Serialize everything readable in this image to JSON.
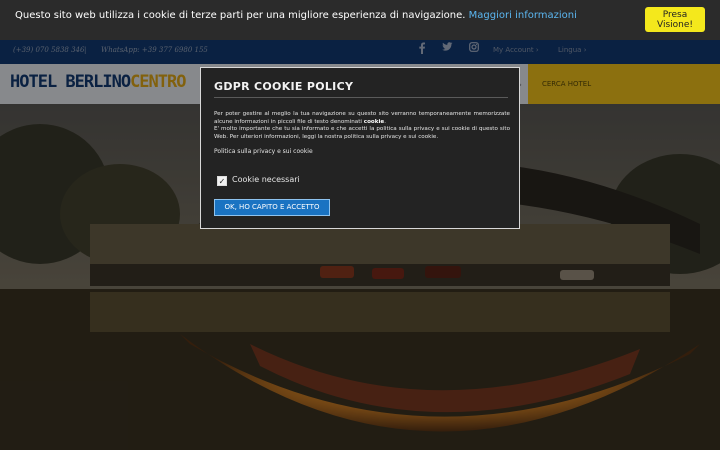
{
  "cookie_bar": {
    "message": "Questo sito web utilizza i cookie di terze parti per una migliore esperienza di navigazione.",
    "link": "Maggiori informazioni",
    "accept_button": "Presa Visione!"
  },
  "topbar": {
    "phone": "(+39) 070 5838 346",
    "divider": "|",
    "whatsapp": "WhatsApp: +39 377 6980 155",
    "icons": [
      "facebook-icon",
      "twitter-icon",
      "instagram-icon"
    ],
    "my_account": "My Account",
    "language": "Lingua"
  },
  "header": {
    "logo_part1": "HOTEL BERLINO",
    "logo_part2": "CENTRO",
    "cerca_hotel": "CERCA HOTEL"
  },
  "modal": {
    "title": "GDPR COOKIE POLICY",
    "paragraph1": "Per poter gestire al meglio la tua navigazione su questo sito verranno temporaneamente memorizzate alcune informazioni in piccoli file di testo denominati",
    "paragraph1_bold": "cookie",
    "paragraph2": "E' molto importante che tu sia informato e che accetti la politica sulla privacy e sui cookie di questo sito Web. Per ulteriori informazioni, leggi la nostra politica sulla privacy e sui cookie.",
    "privacy_link": "Politica sulla privacy e sui cookie",
    "checkbox_label": "Cookie necessari",
    "checkbox_checked": true,
    "accept_button": "OK, HO CAPITO E ACCETTO"
  },
  "colors": {
    "topbar_bg": "#123a72",
    "accent_yellow": "#f1c21a",
    "button_blue": "#1a73c2",
    "link_blue": "#5bb6f0"
  }
}
